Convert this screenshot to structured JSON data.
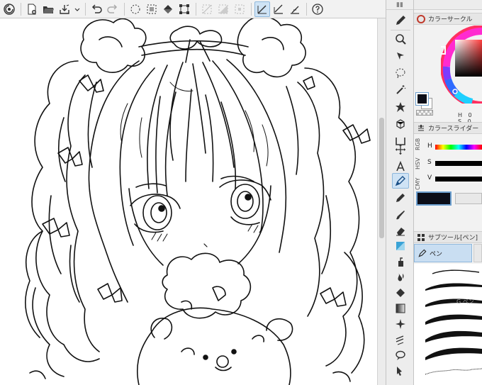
{
  "toolbar": {
    "buttons": [
      "clip-studio-icon",
      "new-file-icon",
      "open-folder-icon",
      "save-icon",
      "undo-icon",
      "redo-icon",
      "clear-selection-icon",
      "select-all-icon",
      "fill-icon",
      "transform-icon",
      "deselect-icon",
      "invert-selection-icon",
      "show-selection-icon",
      "snap-ruler-icon",
      "snap-special-ruler-icon",
      "snap-grid-icon",
      "help-icon"
    ],
    "active": "snap-ruler-icon"
  },
  "tools": [
    "zoom",
    "move-layer",
    "lasso",
    "wand",
    "eyedropper",
    "object",
    "text",
    "pen",
    "pencil",
    "brush",
    "airbrush",
    "blend",
    "eraser",
    "fill",
    "gradient",
    "figure",
    "frame",
    "ruler",
    "balloon",
    "correct-line",
    "operation"
  ],
  "active_tool": "pen",
  "color_wheel_panel": {
    "title": "カラーサークル",
    "hsv_values": "H  0  S  0"
  },
  "color_slider_panel": {
    "title": "カラースライダー",
    "side_tabs": [
      "RGB",
      "HSV",
      "CMY"
    ],
    "labels": [
      "H",
      "S",
      "V"
    ]
  },
  "subtool_panel": {
    "title": "サブツール[ペン]",
    "group_label": "ペン",
    "brush_partial_label": "G ペン"
  },
  "colors": {
    "main": "#0b0d18",
    "sub": "#ffffff",
    "accent": "#8fb8dc"
  }
}
